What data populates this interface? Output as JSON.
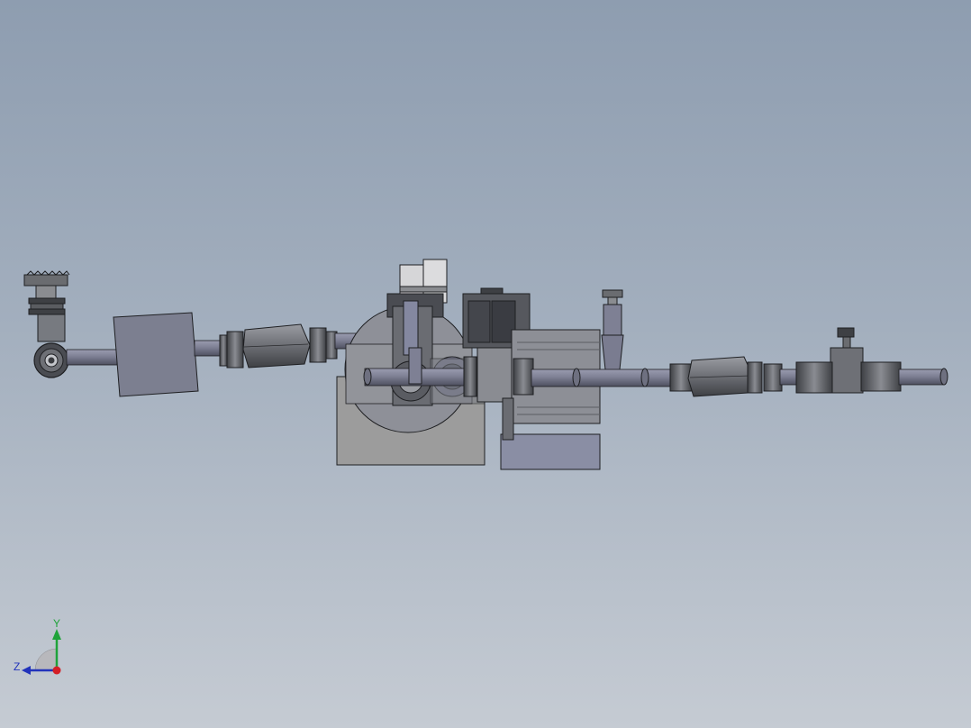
{
  "viewport": {
    "colors": {
      "top": "#8e9db0",
      "bottom": "#c5cbd3"
    }
  },
  "model": {
    "components": [
      "gate-valve",
      "filter-block",
      "hex-coupling-left",
      "pump-motor-assembly",
      "solenoid-valve",
      "pressure-gauge-stem",
      "hex-coupling-right",
      "check-valve",
      "outlet-pipe"
    ],
    "colors": {
      "metal": "#85888d",
      "pipe": "#7e8094",
      "dark": "#4a4c52",
      "edge": "#1e1f22"
    }
  },
  "triad": {
    "y_label": "Y",
    "z_label": "Z",
    "colors": {
      "y": "#1fa33a",
      "z": "#2233bb",
      "x": "#d41f26"
    }
  }
}
